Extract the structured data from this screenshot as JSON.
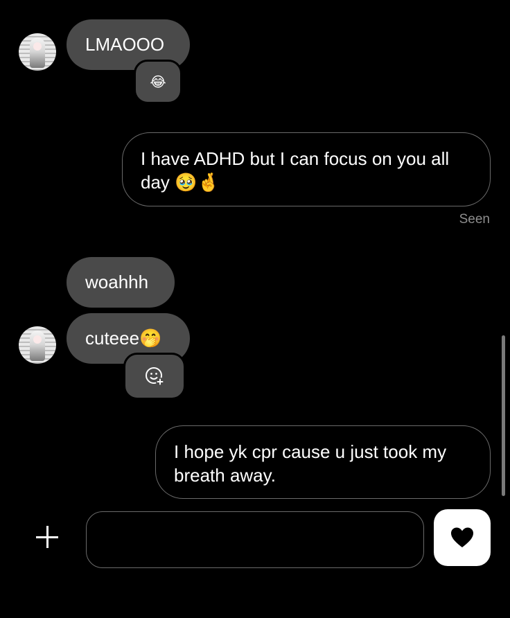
{
  "messages": {
    "m1": {
      "text": "LMAOOO",
      "reaction": "😂"
    },
    "m2": {
      "line1": "I have ADHD but I can focus on you all",
      "line2": "day 🥹🤞"
    },
    "seen": "Seen",
    "m3": {
      "text": "woahhh"
    },
    "m4": {
      "text": "cuteee🤭"
    },
    "m5": {
      "line1": "I hope yk cpr cause u just took my",
      "line2": "breath away."
    }
  },
  "composer": {
    "placeholder": "",
    "value": ""
  },
  "icons": {
    "add": "plus-icon",
    "react": "add-reaction-icon",
    "send": "heart-icon"
  },
  "colors": {
    "background": "#000000",
    "incoming_bubble": "#4a4a4a",
    "outgoing_border": "#6b6b6b",
    "seen": "#8e8e8e"
  }
}
